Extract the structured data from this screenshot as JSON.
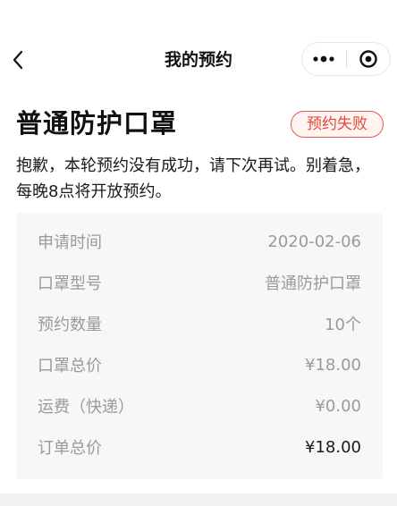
{
  "nav": {
    "title": "我的预约",
    "back_icon": "chevron-left-icon",
    "more_icon": "more-dots-icon",
    "close_icon": "target-close-icon"
  },
  "heading": {
    "title": "普通防护口罩",
    "status": "预约失败",
    "status_color": "#e4473b"
  },
  "message": "抱歉，本轮预约没有成功，请下次再试。别着急，每晚8点将开放预约。",
  "details": [
    {
      "label": "申请时间",
      "value": "2020-02-06"
    },
    {
      "label": "口罩型号",
      "value": "普通防护口罩"
    },
    {
      "label": "预约数量",
      "value": "10个"
    },
    {
      "label": "口罩总价",
      "value": "¥18.00"
    },
    {
      "label": "运费（快递）",
      "value": "¥0.00"
    },
    {
      "label": "订单总价",
      "value": "¥18.00"
    }
  ]
}
